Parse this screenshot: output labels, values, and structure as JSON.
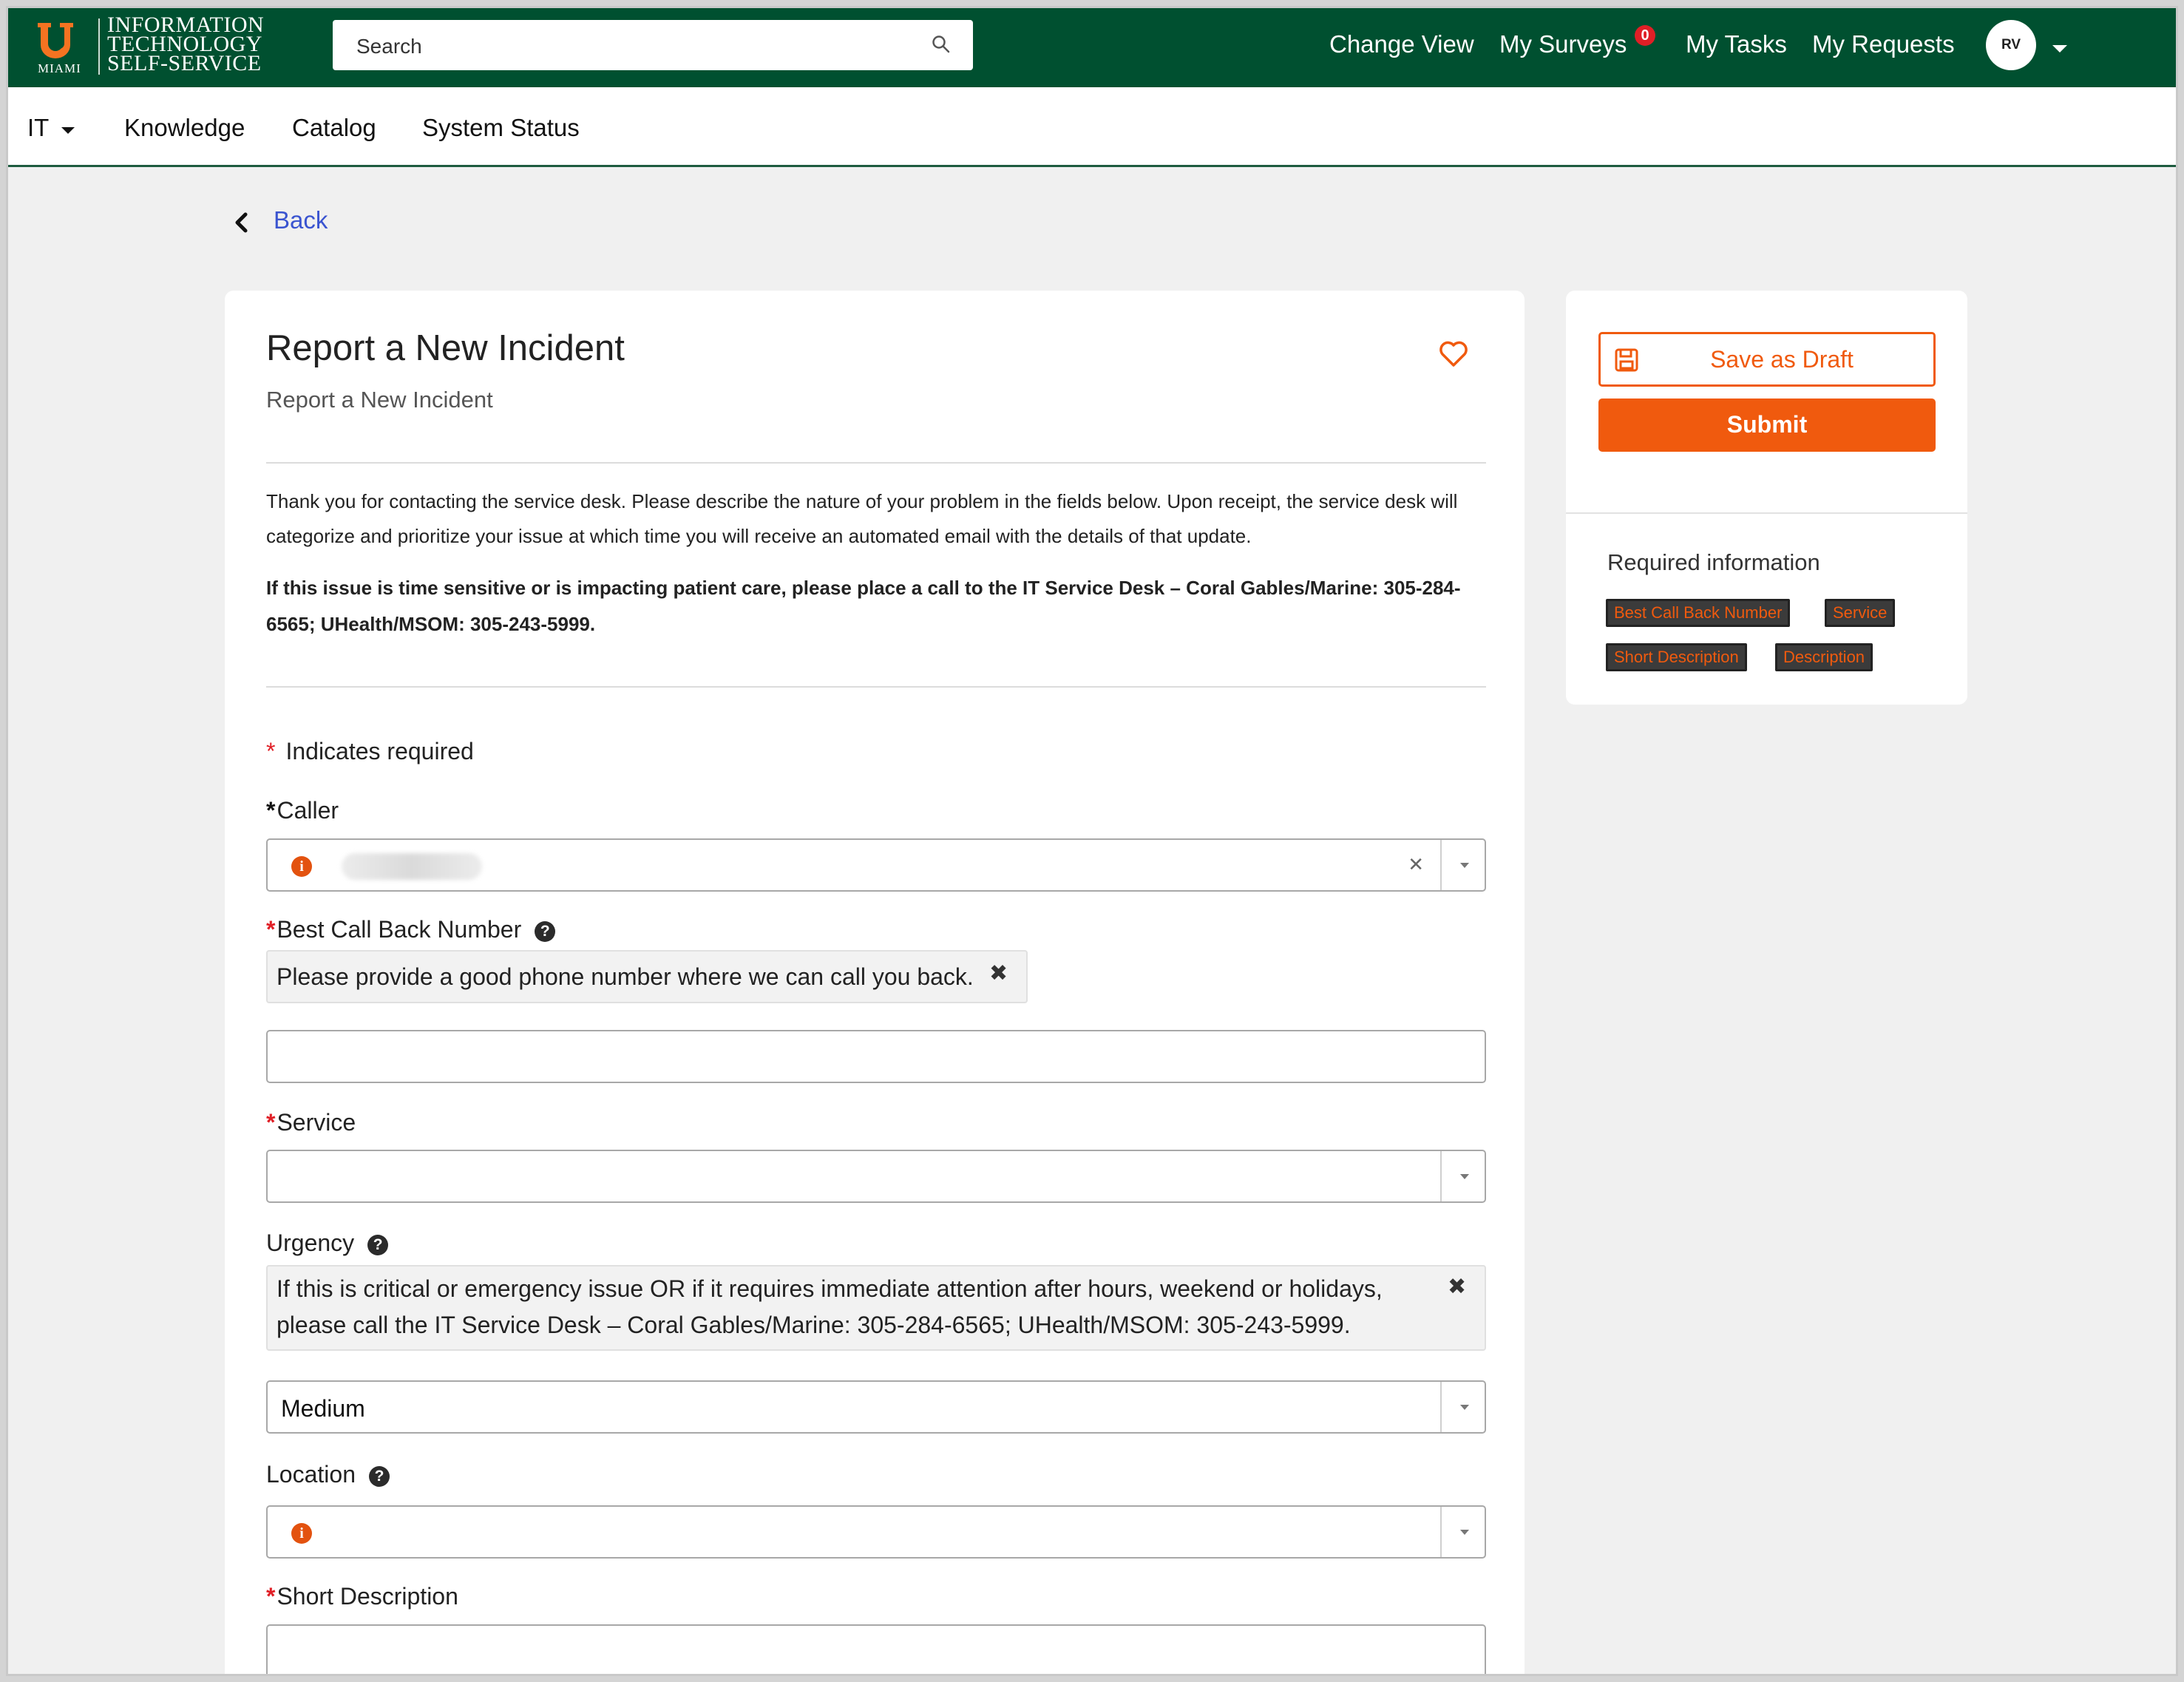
{
  "header": {
    "logo": {
      "wordmark_lines": [
        "INFORMATION",
        "TECHNOLOGY",
        "SELF-SERVICE"
      ],
      "miami": "MIAMI"
    },
    "search_placeholder": "Search",
    "nav": {
      "change_view": "Change View",
      "my_surveys": "My Surveys",
      "surveys_badge": "0",
      "my_tasks": "My Tasks",
      "my_requests": "My Requests"
    },
    "avatar_initials": "RV"
  },
  "subnav": {
    "it": "IT",
    "knowledge": "Knowledge",
    "catalog": "Catalog",
    "system_status": "System Status"
  },
  "back_label": "Back",
  "form": {
    "title": "Report a New Incident",
    "subtitle": "Report a New Incident",
    "intro": "Thank you for contacting the service desk. Please describe the nature of your problem in the fields below. Upon receipt, the service desk will categorize and prioritize your issue at which time you will receive an automated email with the details of that update.",
    "intro_bold": "If this issue is time sensitive or is impacting patient care, please place a call to the IT Service Desk – Coral Gables/Marine: 305-284-6565; UHealth/MSOM: 305-243-5999.",
    "required_note": "Indicates required",
    "caller_label": "Caller",
    "best_call_label": "Best Call Back Number",
    "best_call_hint": "Please provide a good phone number where we can call you back.",
    "service_label": "Service",
    "urgency_label": "Urgency",
    "urgency_hint": "If this is critical or emergency issue OR if it requires immediate attention after hours, weekend or holidays, please call the IT Service Desk – Coral Gables/Marine: 305-284-6565; UHealth/MSOM: 305-243-5999.",
    "urgency_value": "Medium",
    "location_label": "Location",
    "short_desc_label": "Short Description"
  },
  "sidebar": {
    "save_draft": "Save as Draft",
    "submit": "Submit",
    "required_title": "Required information",
    "required_tags": [
      "Best Call Back Number",
      "Service",
      "Short Description",
      "Description"
    ]
  },
  "colors": {
    "header_green": "#005030",
    "accent_orange": "#f05a0e",
    "link_blue": "#3a54d0",
    "required_red": "#e01f26"
  },
  "icons": [
    "u-logo-icon",
    "search-icon",
    "caret-down-icon",
    "chevron-left-icon",
    "heart-icon",
    "info-icon",
    "help-icon",
    "close-icon",
    "save-icon"
  ]
}
